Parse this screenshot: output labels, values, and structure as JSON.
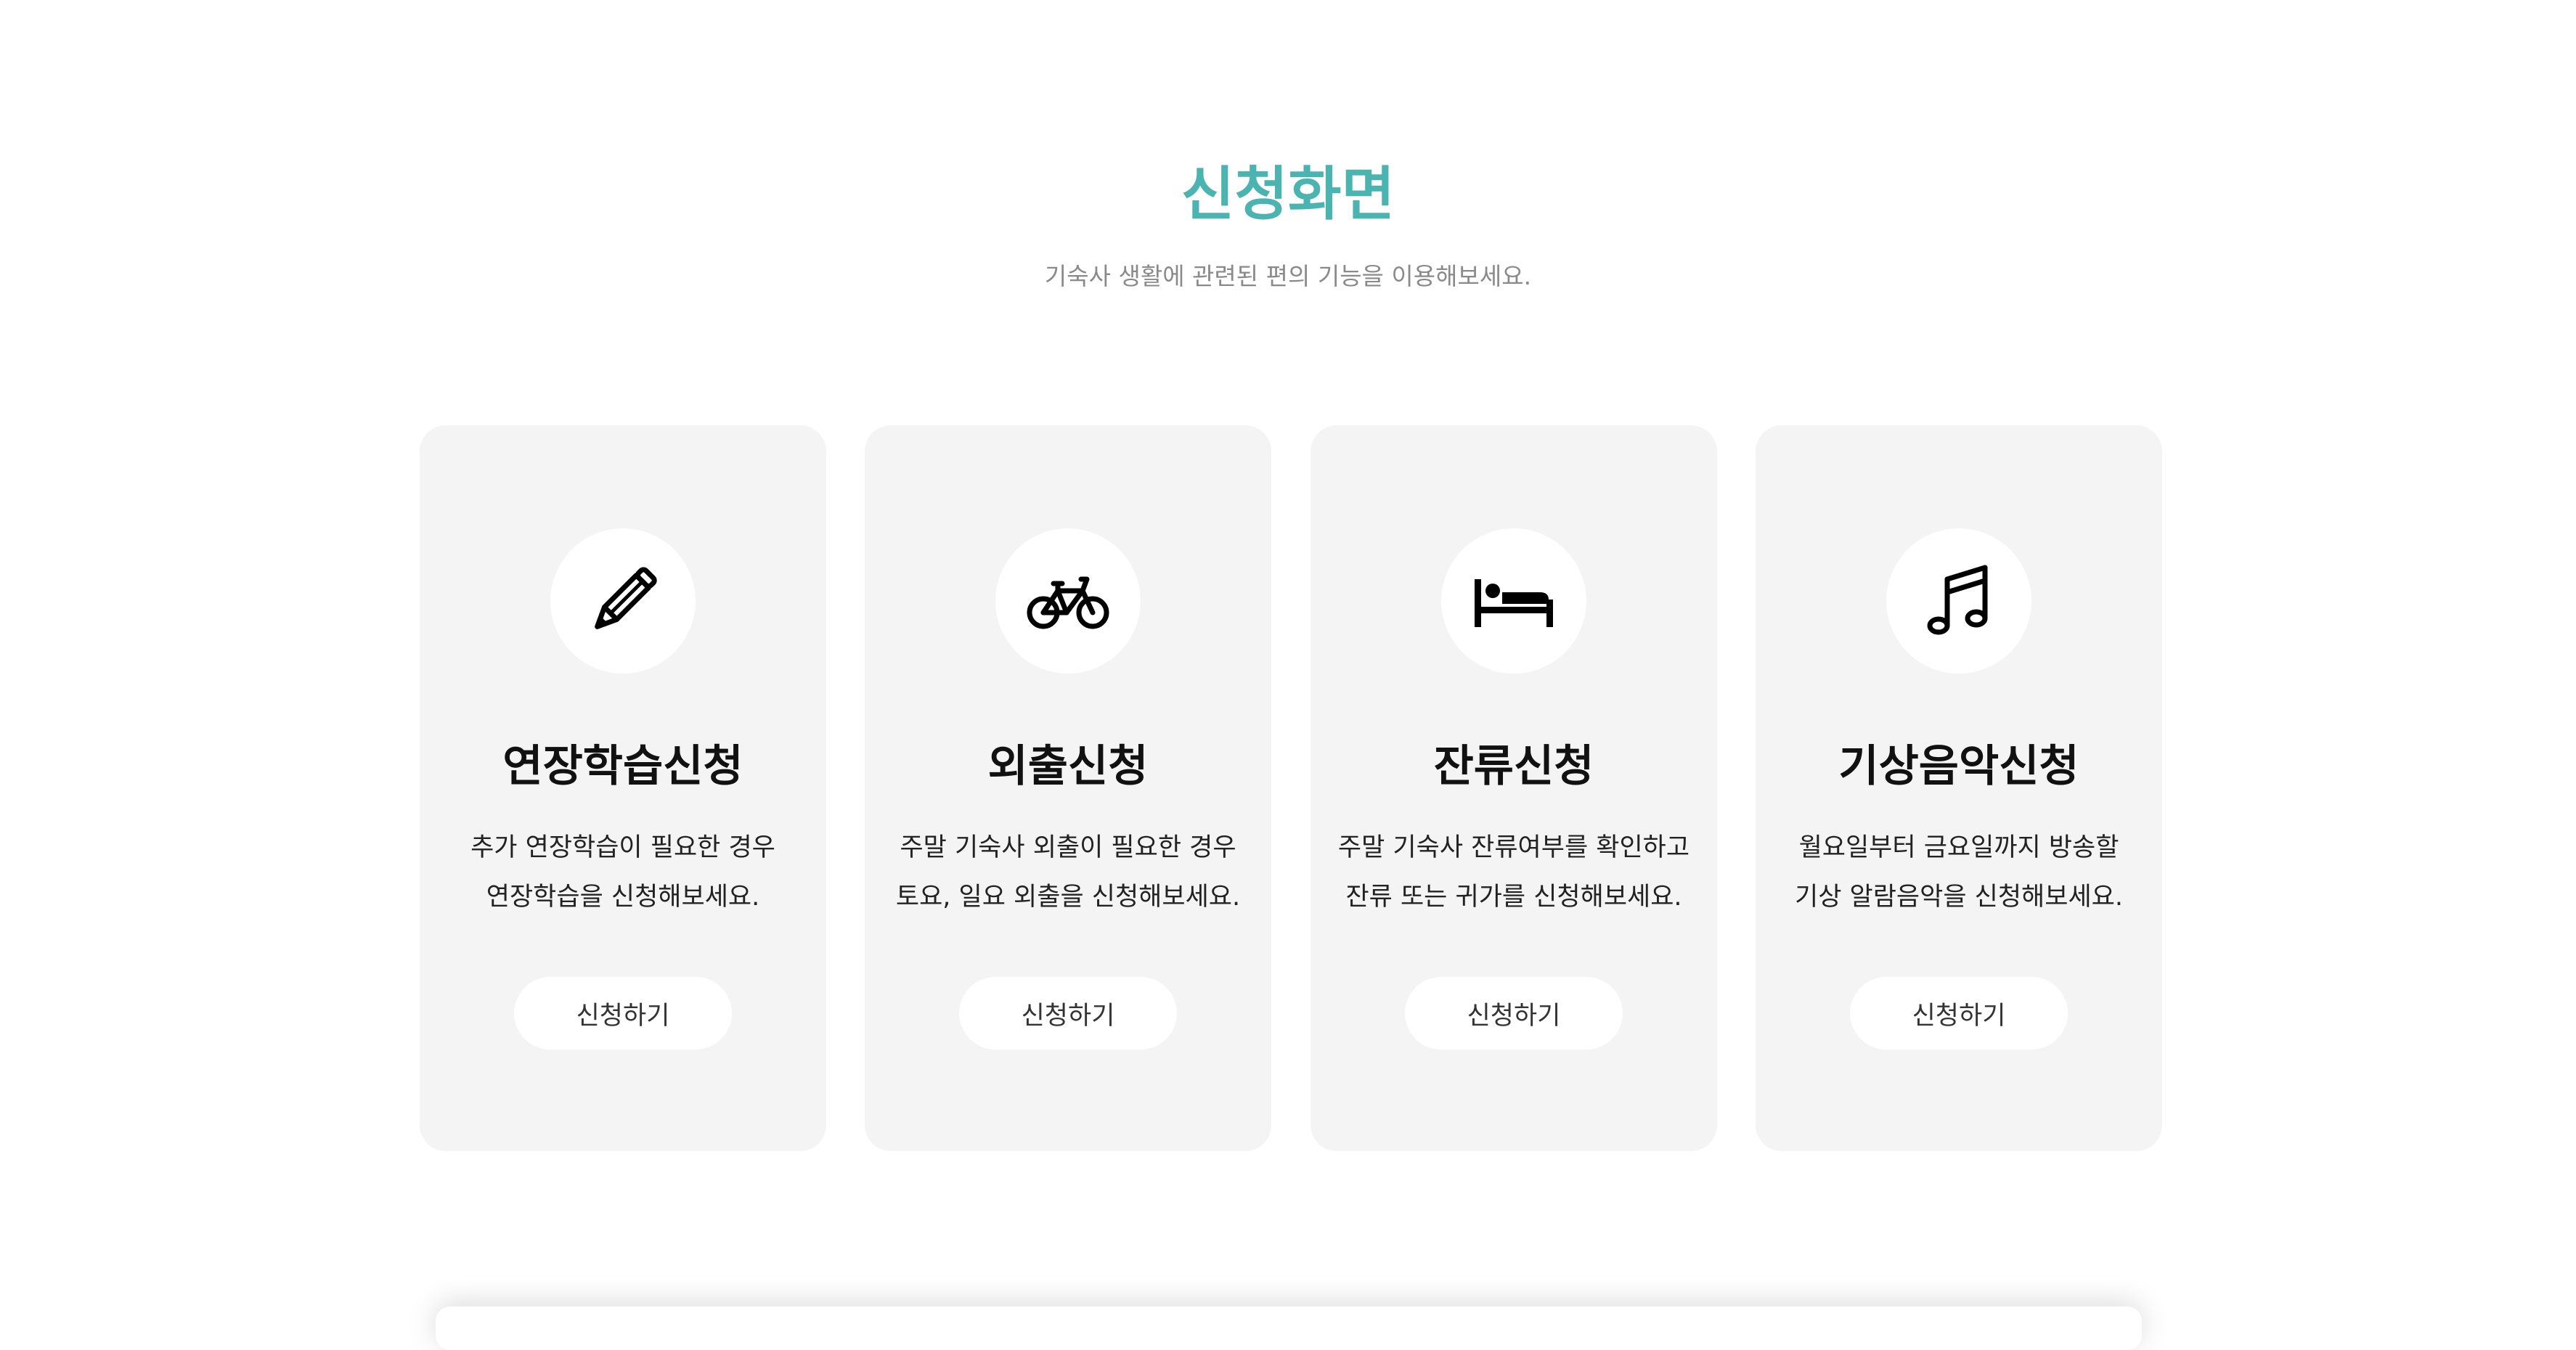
{
  "header": {
    "title": "신청화면",
    "subtitle": "기숙사 생활에 관련된 편의 기능을 이용해보세요."
  },
  "colors": {
    "accent": "#4bb4b1",
    "card_background": "#f4f4f4",
    "subtitle_text": "#8a8a8a"
  },
  "cards": [
    {
      "icon": "pencil-icon",
      "title": "연장학습신청",
      "desc_line1": "추가 연장학습이 필요한 경우",
      "desc_line2": "연장학습을 신청해보세요.",
      "button_label": "신청하기"
    },
    {
      "icon": "bicycle-icon",
      "title": "외출신청",
      "desc_line1": "주말 기숙사 외출이 필요한 경우",
      "desc_line2": "토요, 일요 외출을 신청해보세요.",
      "button_label": "신청하기"
    },
    {
      "icon": "bed-icon",
      "title": "잔류신청",
      "desc_line1": "주말 기숙사 잔류여부를 확인하고",
      "desc_line2": "잔류 또는 귀가를 신청해보세요.",
      "button_label": "신청하기"
    },
    {
      "icon": "music-note-icon",
      "title": "기상음악신청",
      "desc_line1": "월요일부터 금요일까지 방송할",
      "desc_line2": "기상 알람음악을 신청해보세요.",
      "button_label": "신청하기"
    }
  ]
}
